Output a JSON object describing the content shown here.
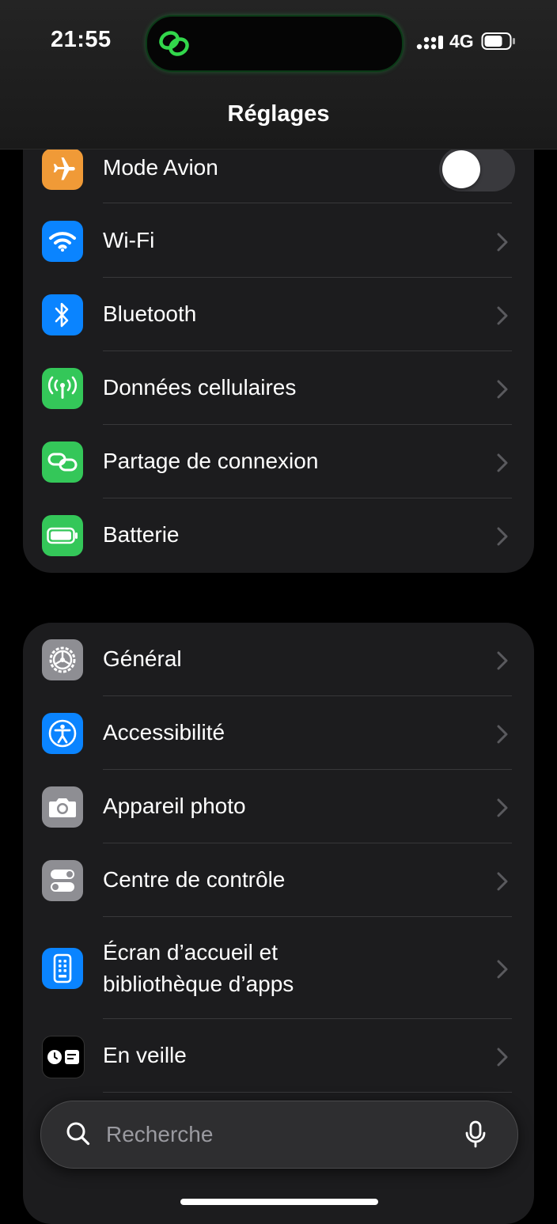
{
  "status_bar": {
    "time": "21:55",
    "network": "4G",
    "signal_bars": 4
  },
  "nav": {
    "title": "Réglages"
  },
  "group1": [
    {
      "label": "Mode Avion",
      "icon": "airplane-icon",
      "color": "#F09A37",
      "control": "toggle",
      "on": false
    },
    {
      "label": "Wi-Fi",
      "icon": "wifi-icon",
      "color": "#0A84FF",
      "control": "chevron"
    },
    {
      "label": "Bluetooth",
      "icon": "bluetooth-icon",
      "color": "#0A84FF",
      "control": "chevron"
    },
    {
      "label": "Données cellulaires",
      "icon": "antenna-icon",
      "color": "#34C759",
      "control": "chevron"
    },
    {
      "label": "Partage de connexion",
      "icon": "hotspot-link-icon",
      "color": "#34C759",
      "control": "chevron"
    },
    {
      "label": "Batterie",
      "icon": "battery-icon",
      "color": "#34C759",
      "control": "chevron"
    }
  ],
  "group2": [
    {
      "label": "Général",
      "icon": "gear-icon",
      "color": "#8E8E93",
      "control": "chevron"
    },
    {
      "label": "Accessibilité",
      "icon": "accessibility-icon",
      "color": "#0A84FF",
      "control": "chevron"
    },
    {
      "label": "Appareil photo",
      "icon": "camera-icon",
      "color": "#8E8E93",
      "control": "chevron"
    },
    {
      "label": "Centre de contrôle",
      "icon": "toggles-icon",
      "color": "#8E8E93",
      "control": "chevron"
    },
    {
      "label_line1": "Écran d’accueil et",
      "label_line2": "bibliothèque d’apps",
      "icon": "home-screen-icon",
      "color": "#0A84FF",
      "control": "chevron"
    },
    {
      "label": "En veille",
      "icon": "standby-icon",
      "color": "#000000",
      "control": "chevron"
    }
  ],
  "search": {
    "placeholder": "Recherche"
  }
}
